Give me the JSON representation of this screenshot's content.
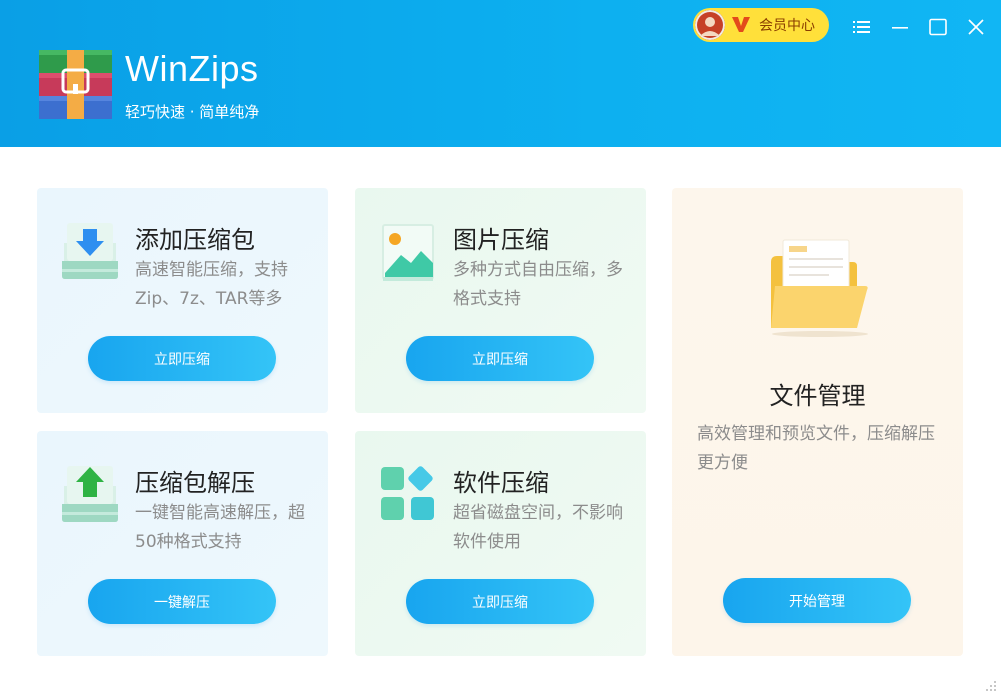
{
  "header": {
    "app_name": "WinZips",
    "slogan": "轻巧快速 · 简单纯净",
    "vip_label": "会员中心",
    "colors": {
      "header_bg": "#0db0f0",
      "vip_bg": "#ffe03a"
    },
    "icons": [
      "logo-icon",
      "avatar-icon",
      "vip-v-icon",
      "menu-icon",
      "minimize-icon",
      "maximize-icon",
      "close-icon"
    ]
  },
  "cards": {
    "add": {
      "title": "添加压缩包",
      "desc": "高速智能压缩，支持Zip、7z、TAR等多",
      "button": "立即压缩",
      "icon": "download-drive-icon"
    },
    "image": {
      "title": "图片压缩",
      "desc": "多种方式自由压缩，多格式支持",
      "button": "立即压缩",
      "icon": "image-icon"
    },
    "unzip": {
      "title": "压缩包解压",
      "desc": "一键智能高速解压，超50种格式支持",
      "button": "一键解压",
      "icon": "upload-drive-icon"
    },
    "software": {
      "title": "软件压缩",
      "desc": "超省磁盘空间，不影响软件使用",
      "button": "立即压缩",
      "icon": "apps-icon"
    },
    "file": {
      "title": "文件管理",
      "desc": "高效管理和预览文件，压缩解压更方便",
      "button": "开始管理",
      "icon": "folder-icon"
    }
  },
  "accent": "#1aa7ef"
}
